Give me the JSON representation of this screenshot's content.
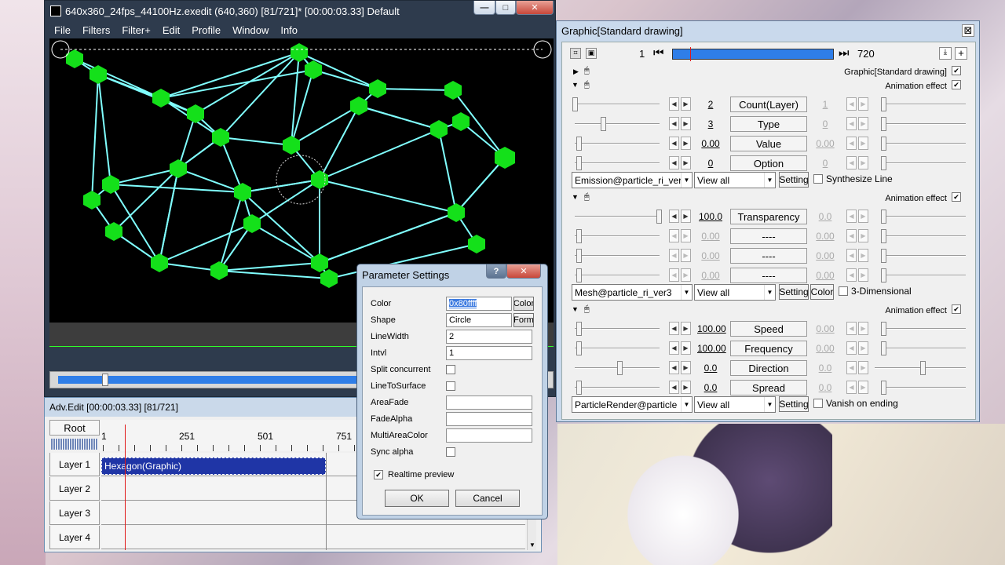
{
  "main_window": {
    "title": "640x360_24fps_44100Hz.exedit (640,360)  [81/721]* [00:00:03.33]  Default",
    "menu": [
      "File",
      "Filters",
      "Filter+",
      "Edit",
      "Profile",
      "Window",
      "Info"
    ]
  },
  "timeline": {
    "title": "Adv.Edit [00:00:03.33] [81/721]",
    "root_label": "Root",
    "ruler_labels": [
      "1",
      "251",
      "501",
      "751"
    ],
    "layers": [
      "Layer 1",
      "Layer 2",
      "Layer 3",
      "Layer 4"
    ],
    "clip_label": "Hexagon(Graphic)"
  },
  "param_dialog": {
    "title": "Parameter Settings",
    "help": "?",
    "close": "✕",
    "rows": [
      {
        "label": "Color",
        "value": "0x80ffff",
        "button": "Color"
      },
      {
        "label": "Shape",
        "value": "Circle",
        "button": "Form"
      },
      {
        "label": "LineWidth",
        "value": "2"
      },
      {
        "label": "Intvl",
        "value": "1"
      },
      {
        "label": "Split concurrent",
        "checkbox": true
      },
      {
        "label": "LineToSurface",
        "checkbox": true
      },
      {
        "label": "AreaFade",
        "value": ""
      },
      {
        "label": "FadeAlpha",
        "value": ""
      },
      {
        "label": "MultiAreaColor",
        "value": ""
      },
      {
        "label": "Sync alpha",
        "checkbox": true
      }
    ],
    "realtime_preview": "Realtime preview",
    "realtime_checked": true,
    "ok": "OK",
    "cancel": "Cancel"
  },
  "graphic_window": {
    "title": "Graphic[Standard drawing]",
    "close": "⊠",
    "frame_start": "1",
    "frame_end": "720",
    "object_label": "Graphic[Standard drawing]",
    "section_label": "Animation effect",
    "params_a": [
      {
        "value": "2",
        "label": "Count(Layer)",
        "right": "1"
      },
      {
        "value": "3",
        "label": "Type",
        "right": "0"
      },
      {
        "value": "0.00",
        "label": "Value",
        "right": "0.00"
      },
      {
        "value": "0",
        "label": "Option",
        "right": "0"
      }
    ],
    "row_a": {
      "select": "Emission@particle_ri_ver",
      "view": "View all",
      "setting": "Setting",
      "check": "Synthesize Line"
    },
    "params_b": [
      {
        "value": "100.0",
        "label": "Transparency",
        "right": "0.0"
      },
      {
        "value": "0.00",
        "label": "----",
        "right": "0.00"
      },
      {
        "value": "0.00",
        "label": "----",
        "right": "0.00"
      },
      {
        "value": "0.00",
        "label": "----",
        "right": "0.00"
      }
    ],
    "row_b": {
      "select": "Mesh@particle_ri_ver3",
      "view": "View all",
      "setting": "Setting",
      "color": "Color",
      "check": "3-Dimensional"
    },
    "params_c": [
      {
        "value": "100.00",
        "label": "Speed",
        "right": "0.00"
      },
      {
        "value": "100.00",
        "label": "Frequency",
        "right": "0.00"
      },
      {
        "value": "0.0",
        "label": "Direction",
        "right": "0.0"
      },
      {
        "value": "0.0",
        "label": "Spread",
        "right": "0.0"
      }
    ],
    "row_c": {
      "select": "ParticleRender@particle",
      "view": "View all",
      "setting": "Setting",
      "check": "Vanish on ending"
    }
  },
  "colors": {
    "mesh_line": "#80ffff",
    "node": "#14e01a",
    "clip": "#1f35a6",
    "seek": "#2f7ee8"
  }
}
